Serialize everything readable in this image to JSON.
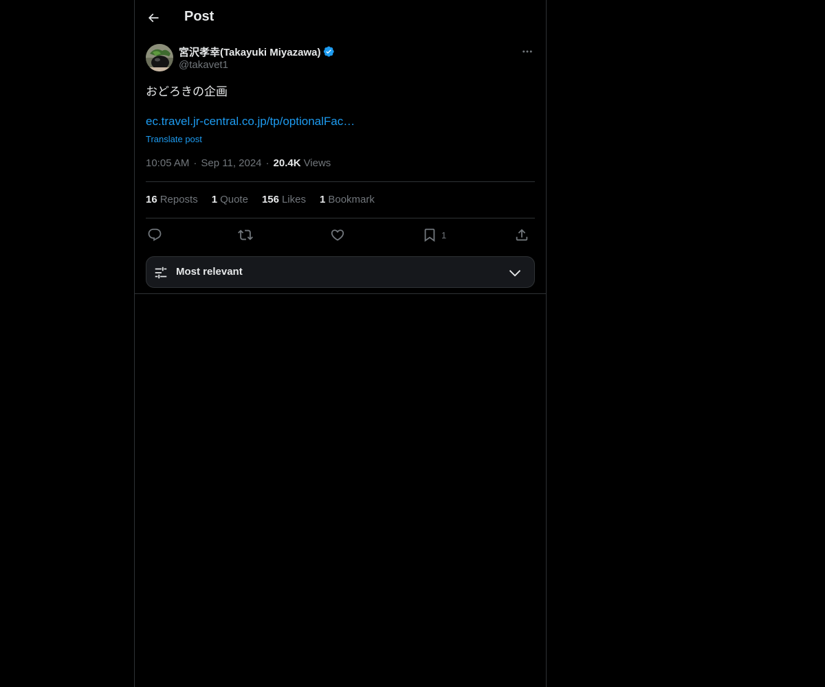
{
  "header": {
    "title": "Post",
    "back_icon": "arrow-left-icon"
  },
  "author": {
    "display_name": "宮沢孝幸(Takayuki Miyazawa)",
    "handle": "@takavet1",
    "verified": true,
    "verified_color": "#1d9bf0",
    "avatar_icon": "avatar-photo"
  },
  "post": {
    "text": "おどろきの企画",
    "link": "ec.travel.jr-central.co.jp/tp/optionalFac…",
    "translate_label": "Translate post",
    "time": "10:05 AM",
    "date": "Sep 11, 2024",
    "views_count": "20.4K",
    "views_label": "Views"
  },
  "stats": [
    {
      "count": "16",
      "label": "Reposts"
    },
    {
      "count": "1",
      "label": "Quote"
    },
    {
      "count": "156",
      "label": "Likes"
    },
    {
      "count": "1",
      "label": "Bookmark"
    }
  ],
  "actions": {
    "reply_icon": "reply-icon",
    "repost_icon": "repost-icon",
    "like_icon": "heart-icon",
    "bookmark_icon": "bookmark-icon",
    "bookmark_count": "1",
    "share_icon": "share-icon"
  },
  "sort": {
    "label": "Most relevant",
    "icon": "sliders-icon",
    "dropdown_icon": "chevron-down-icon"
  },
  "colors": {
    "background": "#000000",
    "text": "#e7e9ea",
    "muted": "#71767b",
    "accent": "#1d9bf0",
    "border": "#2f3336"
  }
}
